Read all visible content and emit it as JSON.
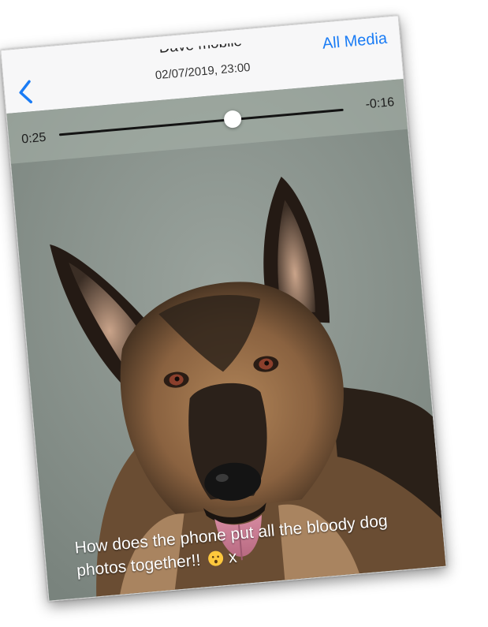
{
  "header": {
    "back_icon": "chevron-left-icon",
    "title": "Dave mobile",
    "timestamp": "02/07/2019, 23:00",
    "all_media_label": "All Media"
  },
  "player": {
    "elapsed": "0:25",
    "remaining": "-0:16",
    "progress_fraction": 0.61
  },
  "caption": {
    "text": "How does the phone put all the bloody dog photos together!!",
    "emoji_icon": "hushed-face-emoji",
    "suffix": "x"
  },
  "colors": {
    "accent": "#1a7cf5",
    "nav_background": "#f7f7f8"
  }
}
